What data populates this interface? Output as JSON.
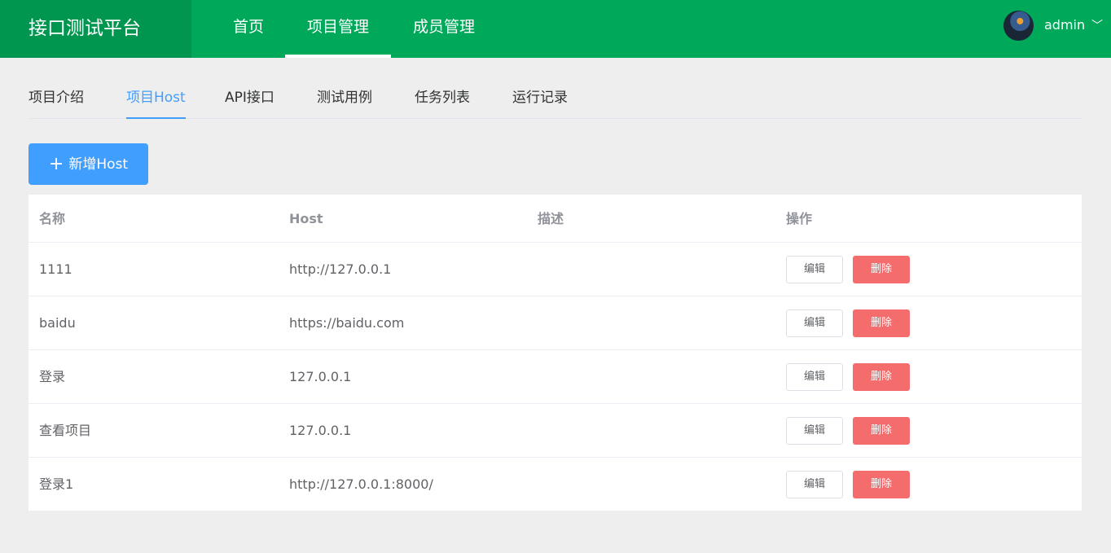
{
  "brand": "接口测试平台",
  "nav": [
    "首页",
    "项目管理",
    "成员管理"
  ],
  "user": {
    "name": "admin",
    "caret": "﹀"
  },
  "tabs": [
    "项目介绍",
    "项目Host",
    "API接口",
    "测试用例",
    "任务列表",
    "运行记录"
  ],
  "add_button": {
    "icon": "+",
    "label": "新增Host"
  },
  "table": {
    "headers": [
      "名称",
      "Host",
      "描述",
      "操作"
    ],
    "rows": [
      {
        "name": "1111",
        "host": "http://127.0.0.1",
        "desc": ""
      },
      {
        "name": "baidu",
        "host": "https://baidu.com",
        "desc": ""
      },
      {
        "name": "登录",
        "host": "127.0.0.1",
        "desc": ""
      },
      {
        "name": "查看项目",
        "host": "127.0.0.1",
        "desc": ""
      },
      {
        "name": "登录1",
        "host": "http://127.0.0.1:8000/",
        "desc": ""
      }
    ],
    "edit_label": "编辑",
    "delete_label": "删除"
  },
  "colors": {
    "topbar": "#00a85a",
    "brand_bg": "#009650",
    "primary": "#409eff",
    "danger": "#f56c6c"
  }
}
